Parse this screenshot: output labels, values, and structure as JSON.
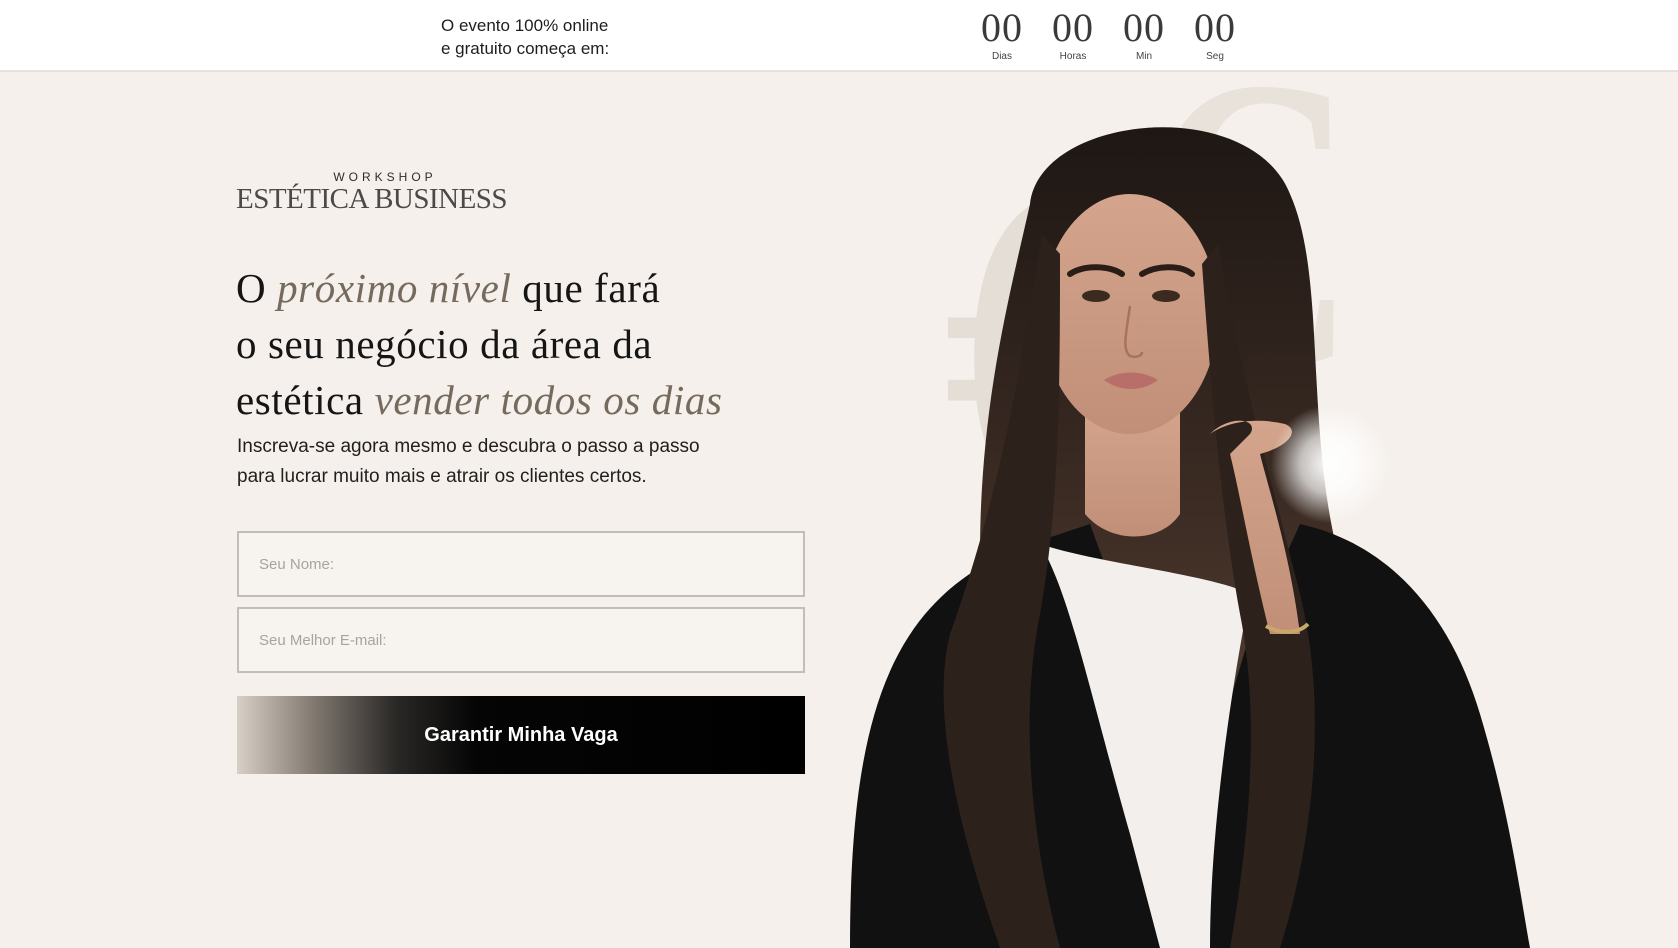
{
  "topbar": {
    "text_line1": "O evento 100% online",
    "text_line2": "e gratuito começa em:",
    "countdown": [
      {
        "value": "00",
        "label": "Dias"
      },
      {
        "value": "00",
        "label": "Horas"
      },
      {
        "value": "00",
        "label": "Min"
      },
      {
        "value": "00",
        "label": "Seg"
      }
    ]
  },
  "brand": {
    "top": "WORKSHOP",
    "main": "ESTÉTICA BUSINESS"
  },
  "headline": {
    "p1": "O ",
    "a1": "próximo nível",
    "p2": " que fará",
    "line2": "o seu negócio da área da",
    "p3": "estética ",
    "a2": "vender todos os dias"
  },
  "subtitle": {
    "line1": "Inscreva-se agora mesmo e descubra o passo a passo",
    "line2": "para lucrar muito mais e atrair os clientes certos."
  },
  "form": {
    "name_placeholder": "Seu Nome:",
    "email_placeholder": "Seu Melhor E-mail:",
    "submit_label": "Garantir Minha Vaga"
  },
  "colors": {
    "background": "#f5f0eb",
    "accent": "#756a5d",
    "button": "#000000"
  }
}
